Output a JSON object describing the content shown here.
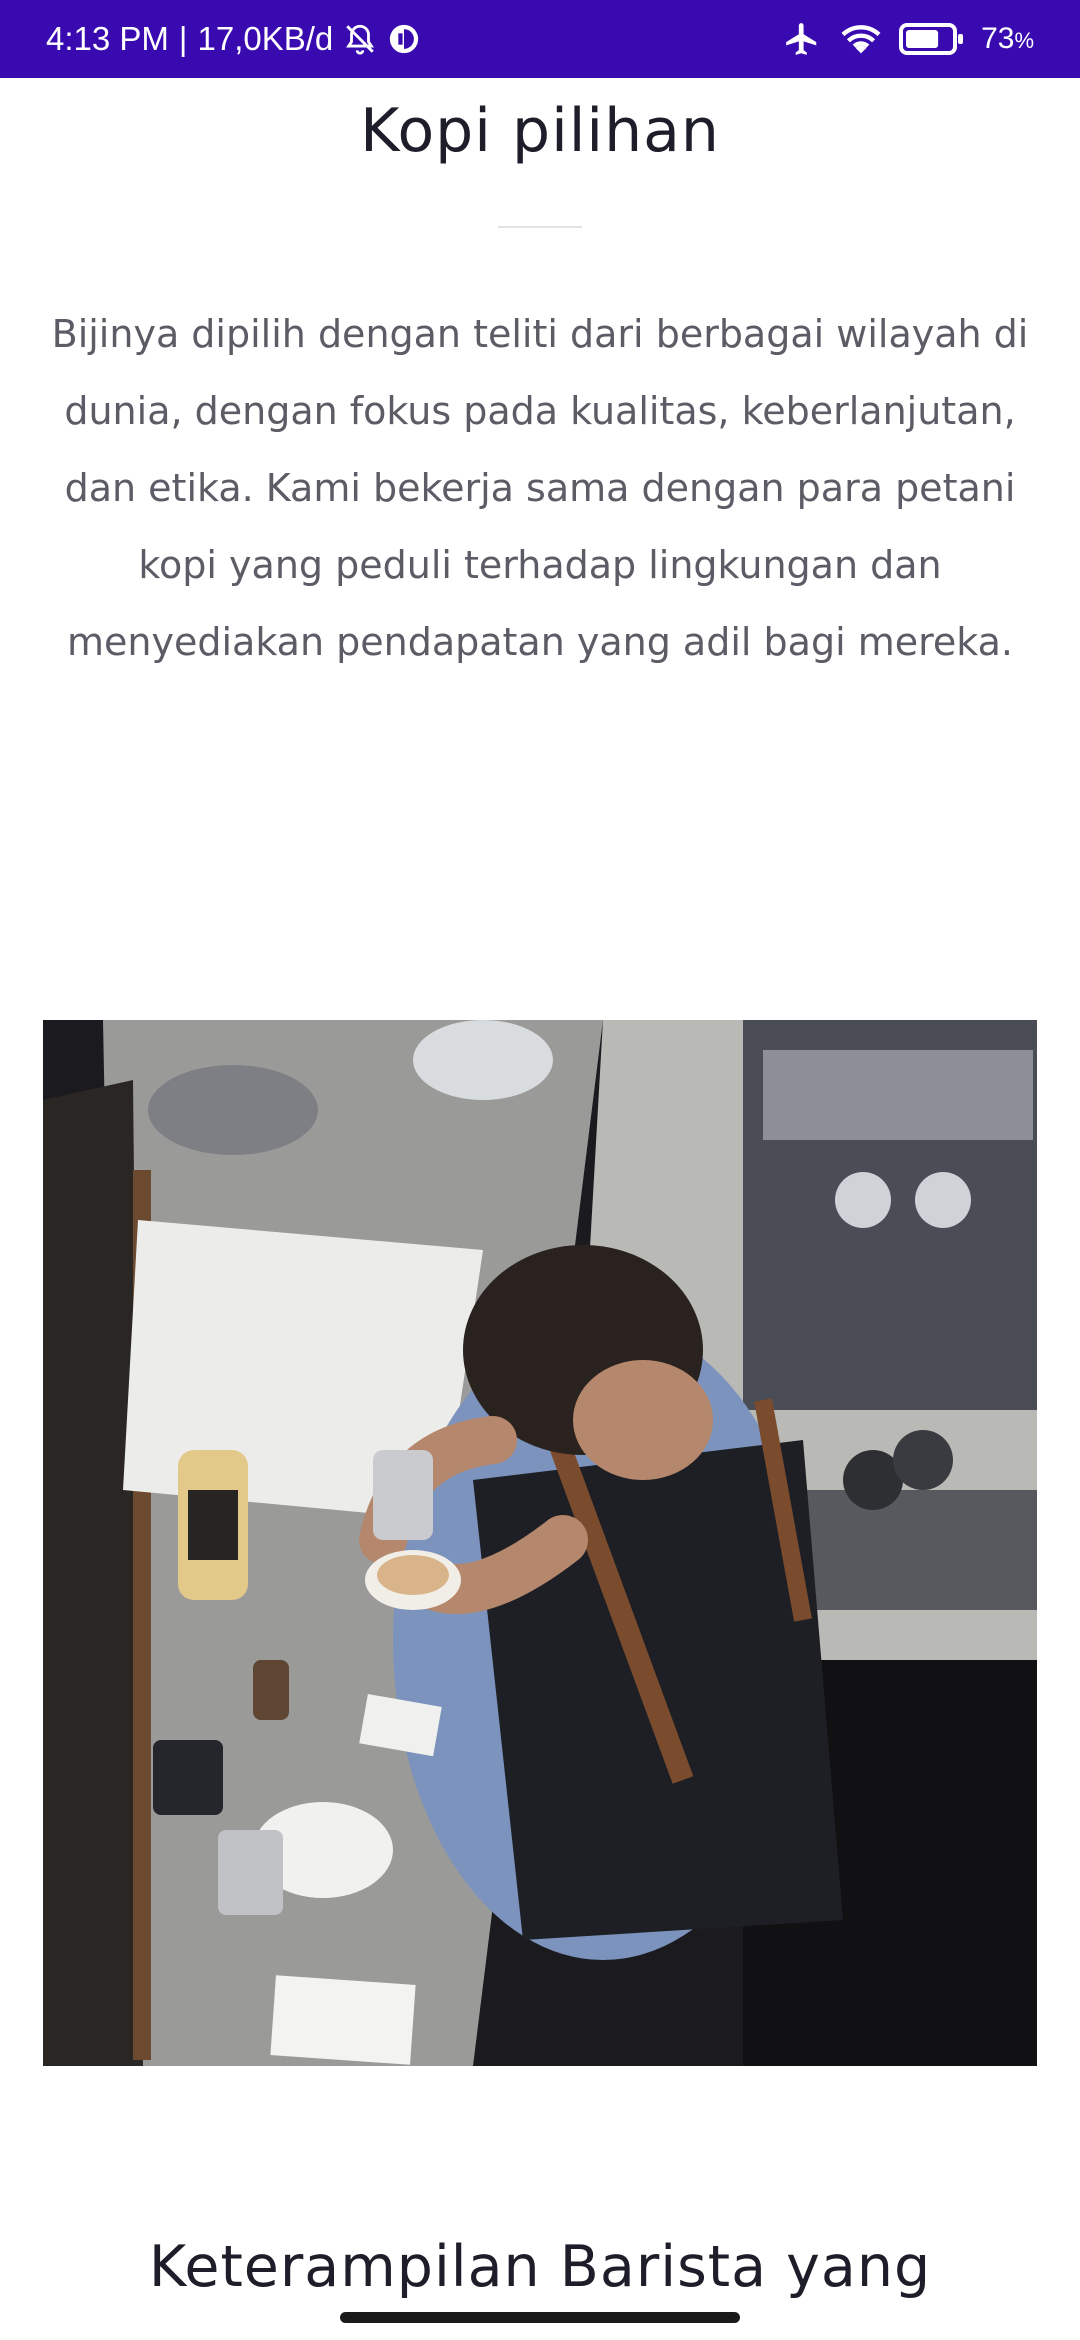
{
  "status_bar": {
    "time": "4:13 PM",
    "separator": "|",
    "network_speed": "17,0KB/d",
    "battery_percent": "73",
    "battery_unit": "%",
    "battery_level": 0.73,
    "icons": [
      "bell-off-icon",
      "data-saver-icon",
      "airplane-icon",
      "wifi-icon",
      "battery-icon"
    ],
    "background": "#3a0ab1"
  },
  "content": {
    "section_title": "Kopi pilihan",
    "section_body": "Bijinya dipilih dengan teliti dari berbagai wilayah di dunia, dengan fokus pada kualitas, keberlanjutan, dan etika. Kami bekerja sama dengan para petani kopi yang peduli terhadap lingkungan dan menyediakan pendapatan yang adil bagi mereka.",
    "next_section_title": "Keterampilan Barista yang"
  }
}
